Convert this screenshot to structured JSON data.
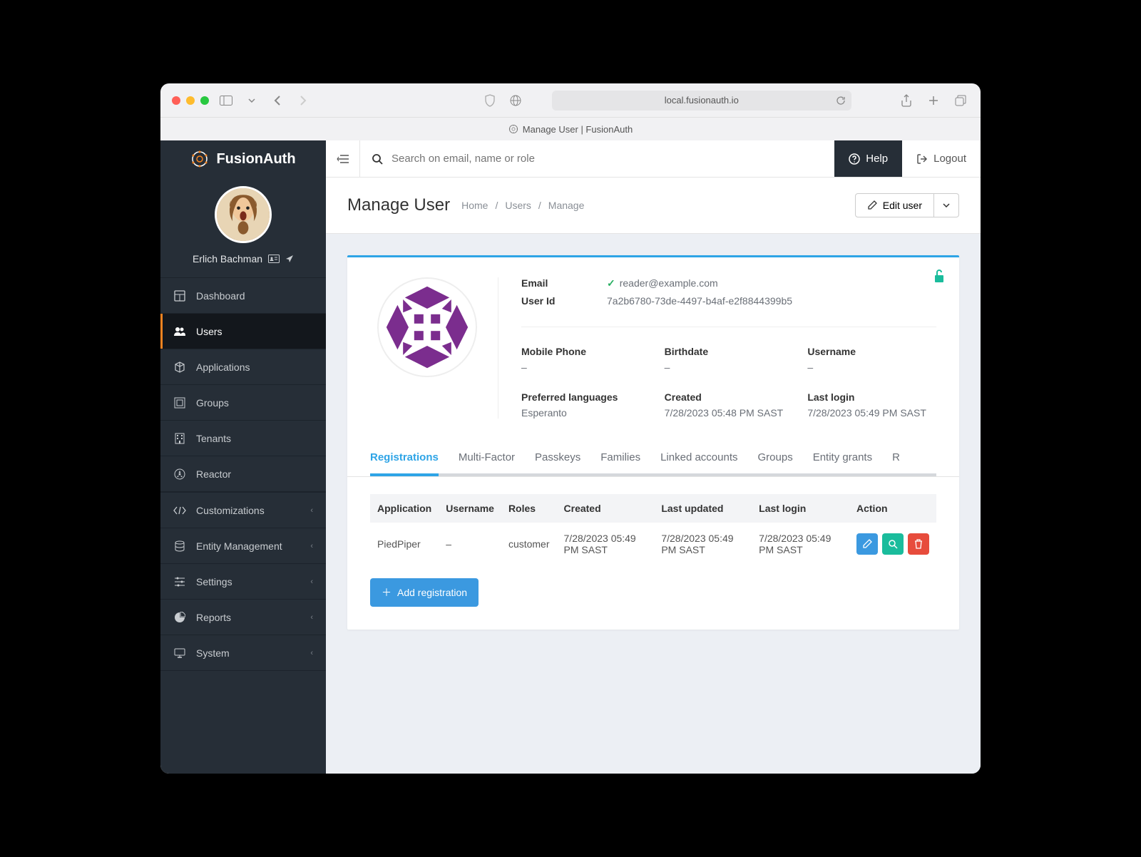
{
  "browser": {
    "url": "local.fusionauth.io",
    "tab_title": "Manage User | FusionAuth"
  },
  "brand": "FusionAuth",
  "current_user": {
    "name": "Erlich Bachman"
  },
  "sidebar": {
    "items": [
      {
        "label": "Dashboard"
      },
      {
        "label": "Users"
      },
      {
        "label": "Applications"
      },
      {
        "label": "Groups"
      },
      {
        "label": "Tenants"
      },
      {
        "label": "Reactor"
      },
      {
        "label": "Customizations"
      },
      {
        "label": "Entity Management"
      },
      {
        "label": "Settings"
      },
      {
        "label": "Reports"
      },
      {
        "label": "System"
      }
    ],
    "active_index": 1
  },
  "topbar": {
    "search_placeholder": "Search on email, name or role",
    "help_label": "Help",
    "logout_label": "Logout"
  },
  "page": {
    "title": "Manage User",
    "breadcrumb": [
      "Home",
      "Users",
      "Manage"
    ],
    "edit_label": "Edit user"
  },
  "user": {
    "email_label": "Email",
    "email": "reader@example.com",
    "email_verified": true,
    "userid_label": "User Id",
    "userid": "7a2b6780-73de-4497-b4af-e2f8844399b5",
    "fields": {
      "mobile_phone": {
        "label": "Mobile Phone",
        "value": "–"
      },
      "birthdate": {
        "label": "Birthdate",
        "value": "–"
      },
      "username": {
        "label": "Username",
        "value": "–"
      },
      "preferred_languages": {
        "label": "Preferred languages",
        "value": "Esperanto"
      },
      "created": {
        "label": "Created",
        "value": "7/28/2023 05:48 PM SAST"
      },
      "last_login": {
        "label": "Last login",
        "value": "7/28/2023 05:49 PM SAST"
      }
    }
  },
  "tabs": [
    "Registrations",
    "Multi-Factor",
    "Passkeys",
    "Families",
    "Linked accounts",
    "Groups",
    "Entity grants",
    "R"
  ],
  "active_tab": 0,
  "registrations": {
    "columns": [
      "Application",
      "Username",
      "Roles",
      "Created",
      "Last updated",
      "Last login",
      "Action"
    ],
    "rows": [
      {
        "application": "PiedPiper",
        "username": "–",
        "roles": "customer",
        "created": "7/28/2023 05:49 PM SAST",
        "last_updated": "7/28/2023 05:49 PM SAST",
        "last_login": "7/28/2023 05:49 PM SAST"
      }
    ],
    "add_label": "Add registration"
  },
  "colors": {
    "accent_orange": "#f58320",
    "accent_blue": "#2ea4e6",
    "sidebar_bg": "#262e37"
  }
}
